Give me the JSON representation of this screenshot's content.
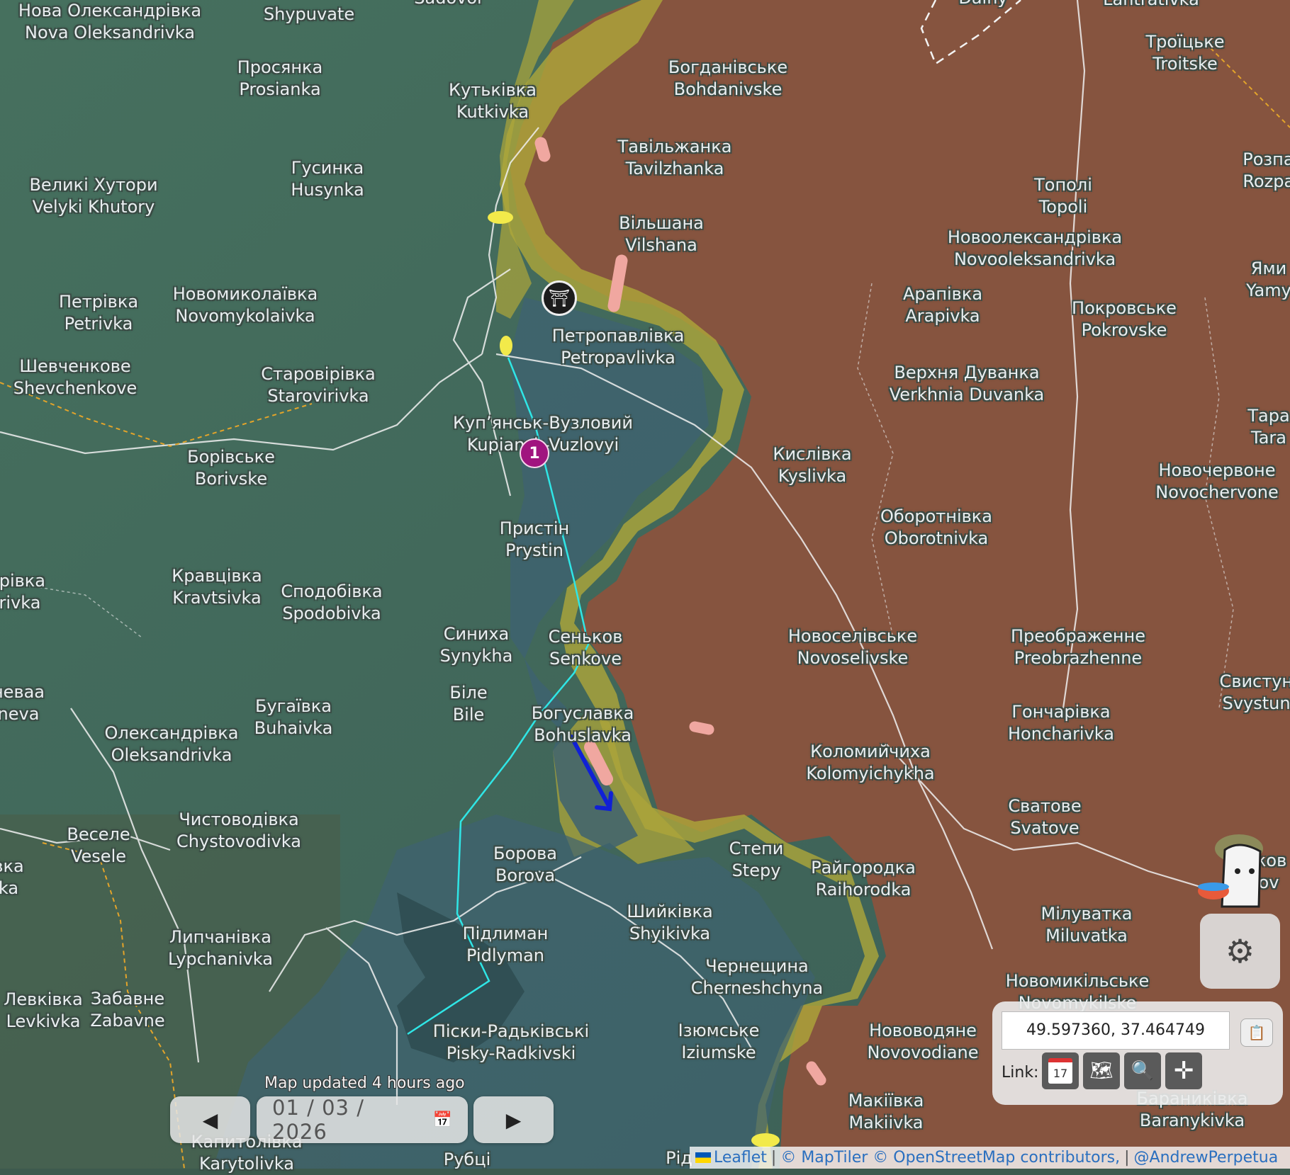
{
  "map": {
    "places": [
      {
        "ua": "Нова Олександрівка",
        "en": "Nova Oleksandrivka"
      },
      {
        "ua": "Shypuvate",
        "en": ""
      },
      {
        "ua": "Sadovoi",
        "en": ""
      },
      {
        "ua": "Dalny",
        "en": ""
      },
      {
        "ua": "Lantratıvka",
        "en": ""
      },
      {
        "ua": "Просянка",
        "en": "Prosianka"
      },
      {
        "ua": "Кутьківка",
        "en": "Kutkivka"
      },
      {
        "ua": "Богданівське",
        "en": "Bohdanivske"
      },
      {
        "ua": "Троїцьке",
        "en": "Troitske"
      },
      {
        "ua": "Тавільжанка",
        "en": "Tavilzhanka"
      },
      {
        "ua": "Великі Хутори",
        "en": "Velyki Khutory"
      },
      {
        "ua": "Гусинка",
        "en": "Husynka"
      },
      {
        "ua": "Тополі",
        "en": "Topoli"
      },
      {
        "ua": "Розпас",
        "en": "Rozpas"
      },
      {
        "ua": "Вільшана",
        "en": "Vilshana"
      },
      {
        "ua": "Новоолександрівка",
        "en": "Novooleksandrivka"
      },
      {
        "ua": "Петрівка",
        "en": "Petrivka"
      },
      {
        "ua": "Новомиколаївка",
        "en": "Novomykolaivka"
      },
      {
        "ua": "Арапівка",
        "en": "Arapivka"
      },
      {
        "ua": "Покровське",
        "en": "Pokrovske"
      },
      {
        "ua": "Ями",
        "en": "Yamy"
      },
      {
        "ua": "Петропавлівка",
        "en": "Petropavlivka"
      },
      {
        "ua": "Шевченкове",
        "en": "Shevchenkove"
      },
      {
        "ua": "Старовірівка",
        "en": "Starovirivka"
      },
      {
        "ua": "Верхня Дуванка",
        "en": "Verkhnia Duvanka"
      },
      {
        "ua": "Тара",
        "en": "Tara"
      },
      {
        "ua": "Куп’янськ-Вузловий",
        "en": "Kupiansk-Vuzlovyi"
      },
      {
        "ua": "Борівське",
        "en": "Borivske"
      },
      {
        "ua": "Кислівка",
        "en": "Kyslivka"
      },
      {
        "ua": "Новочервоне",
        "en": "Novochervone"
      },
      {
        "ua": "Оборотнівка",
        "en": "Oborotnivka"
      },
      {
        "ua": "Пристін",
        "en": "Prystin"
      },
      {
        "ua": "ірівка",
        "en": "rivka"
      },
      {
        "ua": "Кравцівка",
        "en": "Kravtsivka"
      },
      {
        "ua": "Сподобівка",
        "en": "Spodobivka"
      },
      {
        "ua": "Синиха",
        "en": "Synykha"
      },
      {
        "ua": "Сеньков",
        "en": "Senkove"
      },
      {
        "ua": "Новоселівське",
        "en": "Novoselivske"
      },
      {
        "ua": "Преображенне",
        "en": "Preobrazhenne"
      },
      {
        "ua": "неваa",
        "en": "neva"
      },
      {
        "ua": "Свистунівк",
        "en": "Svystunivk"
      },
      {
        "ua": "Біле",
        "en": "Bile"
      },
      {
        "ua": "Бугаївка",
        "en": "Buhaivka"
      },
      {
        "ua": "Богуславка",
        "en": "Bohuslavka"
      },
      {
        "ua": "Гончарівка",
        "en": "Honcharivka"
      },
      {
        "ua": "Олександрівка",
        "en": "Oleksandrivka"
      },
      {
        "ua": "Коломийчиха",
        "en": "Kolomyichykha"
      },
      {
        "ua": "Сватове",
        "en": "Svatove"
      },
      {
        "ua": "Чистоводівка",
        "en": "Chystovodivka"
      },
      {
        "ua": "Веселе",
        "en": "Vesele"
      },
      {
        "ua": "вка",
        "en": "ka"
      },
      {
        "ua": "Степи",
        "en": "Stepy"
      },
      {
        "ua": "Райгородка",
        "en": "Raihorodka"
      },
      {
        "ua": "Борова",
        "en": "Borova"
      },
      {
        "ua": "жов",
        "en": "ov"
      },
      {
        "ua": "Шийківка",
        "en": "Shyikivka"
      },
      {
        "ua": "Мілуватка",
        "en": "Miluvatka"
      },
      {
        "ua": "Підлиман",
        "en": "Pidlyman"
      },
      {
        "ua": "Липчанівка",
        "en": "Lypchanivka"
      },
      {
        "ua": "Чернещина",
        "en": "Cherneshchyna"
      },
      {
        "ua": "Новомикільське",
        "en": "Novomykilske"
      },
      {
        "ua": "Левківка",
        "en": "Levkivka"
      },
      {
        "ua": "Забавне",
        "en": "Zabavne"
      },
      {
        "ua": "Піски-Радьківські",
        "en": "Pisky-Radkivski"
      },
      {
        "ua": "Ізюмське",
        "en": "Iziumske"
      },
      {
        "ua": "Нововодяне",
        "en": "Novovodiane"
      },
      {
        "ua": "Макіївка",
        "en": "Makiivka"
      },
      {
        "ua": "Бараниківка",
        "en": "Baranykivka"
      },
      {
        "ua": "Капитолівка",
        "en": "Karytolivka"
      },
      {
        "ua": "Рубці",
        "en": ""
      },
      {
        "ua": "Рід",
        "en": ""
      }
    ],
    "marker_number": "1",
    "hq_icon": "headquarters-icon",
    "colors": {
      "ukraine_controlled": "#3e6472",
      "russia_controlled": "#8a5640",
      "contested": "#b6b23c",
      "frontline": "#2fe6e6",
      "advance_arrow": "#1020d6",
      "claim_pink": "#f0a7a0",
      "claim_yellow": "#f2ea4a",
      "marker": "#a0147f"
    }
  },
  "controls": {
    "updated_text": "Map updated 4 hours ago",
    "prev_label": "◀",
    "next_label": "▶",
    "date_value": "01 / 03 / 2026",
    "calendar_icon": "calendar-icon",
    "gear_icon": "gear-icon",
    "coordinates": "49.597360, 37.464749",
    "copy_icon": "clipboard-icon",
    "link_label": "Link:",
    "link_buttons": [
      "calendar-link-icon",
      "world-map-icon",
      "search-icon",
      "crosshair-icon"
    ],
    "link_calendar_text": "17"
  },
  "attribution": {
    "leaflet": "Leaflet",
    "maptiler": "© MapTiler © OpenStreetMap contributors,",
    "author": "@AndrewPerpetua"
  }
}
